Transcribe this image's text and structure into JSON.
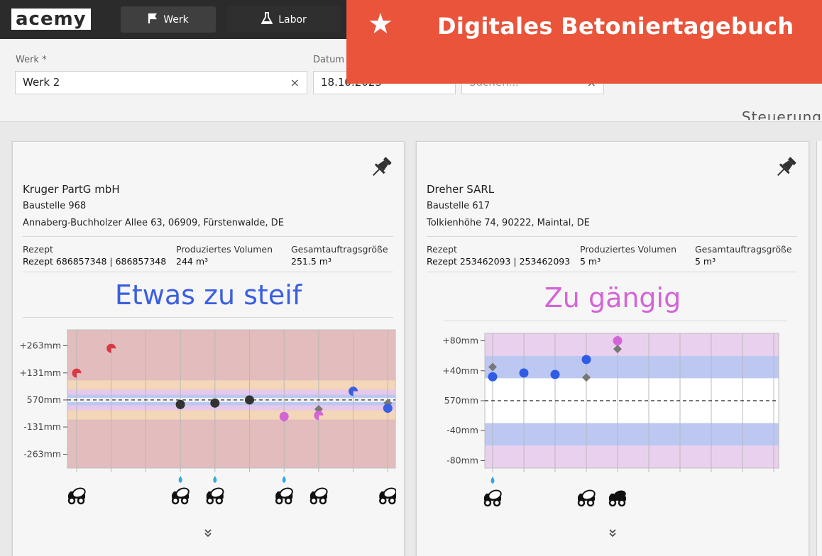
{
  "nav": {
    "logo": "acemy",
    "werk_label": "Werk",
    "labor_label": "Labor"
  },
  "banner": {
    "title": "Digitales Betoniertagebuch",
    "star_icon": "star-icon"
  },
  "filters": {
    "werk_label": "Werk *",
    "werk_value": "Werk 2",
    "datum_label": "Datum",
    "datum_value": "18.10.2023",
    "search_placeholder": "Suchen...",
    "clear_symbol": "×",
    "cut_text": "Steuerung"
  },
  "cards": [
    {
      "company": "Kruger PartG mbH",
      "site": "Baustelle 968",
      "address": "Annaberg-Buchholzer Allee 63, 06909, Fürstenwalde, DE",
      "recipe_header": "Rezept",
      "recipe_value": "Rezept 686857348 | 686857348",
      "volume_header": "Produziertes Volumen",
      "volume_value": "244 m³",
      "order_header": "Gesamtauftragsgröße",
      "order_value": "251.5 m³",
      "status": "Etwas zu steif",
      "status_color": "#3a5fe0",
      "expand_icon": "chevron-double-down-icon"
    },
    {
      "company": "Dreher SARL",
      "site": "Baustelle 617",
      "address": "Tolkienhöhe 74, 90222, Maintal, DE",
      "recipe_header": "Rezept",
      "recipe_value": "Rezept 253462093 | 253462093",
      "volume_header": "Produziertes Volumen",
      "volume_value": "5 m³",
      "order_header": "Gesamtauftragsgröße",
      "order_value": "5 m³",
      "status": "Zu gängig",
      "status_color": "#d465d6",
      "expand_icon": "chevron-double-down-icon"
    }
  ],
  "chart_data": [
    {
      "type": "scatter",
      "yticklabels": [
        "+263mm",
        "+131mm",
        "570mm",
        "-131mm",
        "-263mm"
      ],
      "yticks": [
        263,
        131,
        0,
        -131,
        -263
      ],
      "ylim": [
        -330,
        340
      ],
      "reference": 0,
      "slots": 10,
      "background": "#e3bcbd",
      "bands": [
        {
          "from": 50,
          "to": 95,
          "color": "#f4d6b8"
        },
        {
          "from": -95,
          "to": -50,
          "color": "#f4d6b8"
        },
        {
          "from": 25,
          "to": 50,
          "color": "#e6c8ea"
        },
        {
          "from": -50,
          "to": -25,
          "color": "#e6c8ea"
        },
        {
          "from": 10,
          "to": 25,
          "color": "#b9c9f2"
        },
        {
          "from": -25,
          "to": -10,
          "color": "#b9c9f2"
        },
        {
          "from": -10,
          "to": 10,
          "color": "#f3f3f3"
        }
      ],
      "markers": [
        {
          "slot": 0,
          "value": 130,
          "color": "#d63a44",
          "shape": "pie"
        },
        {
          "slot": 1,
          "value": 250,
          "color": "#d63a44",
          "shape": "pie"
        },
        {
          "slot": 3,
          "value": -22,
          "color": "#333333",
          "shape": "dot"
        },
        {
          "slot": 4,
          "value": -15,
          "color": "#333333",
          "shape": "dot"
        },
        {
          "slot": 5,
          "value": 0,
          "color": "#333333",
          "shape": "dot"
        },
        {
          "slot": 6,
          "value": -85,
          "color": "#666666",
          "shape": "diamond"
        },
        {
          "slot": 6,
          "value": -80,
          "color": "#d465d6",
          "shape": "dot"
        },
        {
          "slot": 7,
          "value": -45,
          "color": "#777777",
          "shape": "diamond"
        },
        {
          "slot": 7,
          "value": -75,
          "color": "#d465d6",
          "shape": "pie"
        },
        {
          "slot": 8,
          "value": 42,
          "color": "#3a5fe0",
          "shape": "pie"
        },
        {
          "slot": 9,
          "value": -15,
          "color": "#777777",
          "shape": "diamond"
        },
        {
          "slot": 9,
          "value": -40,
          "color": "#3a5fe0",
          "shape": "dot"
        }
      ],
      "drops": [
        3,
        4,
        6
      ],
      "trucks": [
        {
          "slot": 0,
          "style": "mixer"
        },
        {
          "slot": 3,
          "style": "mixer"
        },
        {
          "slot": 4,
          "style": "mixer"
        },
        {
          "slot": 6,
          "style": "mixer"
        },
        {
          "slot": 7,
          "style": "mixer"
        },
        {
          "slot": 9,
          "style": "mixer"
        }
      ]
    },
    {
      "type": "scatter",
      "yticklabels": [
        "+80mm",
        "+40mm",
        "570mm",
        "-40mm",
        "-80mm"
      ],
      "yticks": [
        80,
        40,
        0,
        -40,
        -80
      ],
      "ylim": [
        -90,
        90
      ],
      "reference": 0,
      "slots": 10,
      "background": "#ffffff",
      "bands": [
        {
          "from": 60,
          "to": 90,
          "color": "#ead0ef"
        },
        {
          "from": -90,
          "to": -60,
          "color": "#ead0ef"
        },
        {
          "from": 30,
          "to": 60,
          "color": "#bcc8f2"
        },
        {
          "from": -60,
          "to": -30,
          "color": "#bcc8f2"
        }
      ],
      "markers": [
        {
          "slot": 0,
          "value": 45,
          "color": "#777777",
          "shape": "diamond"
        },
        {
          "slot": 0,
          "value": 32,
          "color": "#2f5be6",
          "shape": "dot"
        },
        {
          "slot": 1,
          "value": 37,
          "color": "#2f5be6",
          "shape": "dot"
        },
        {
          "slot": 2,
          "value": 35,
          "color": "#2f5be6",
          "shape": "dot"
        },
        {
          "slot": 3,
          "value": 55,
          "color": "#2f5be6",
          "shape": "dot"
        },
        {
          "slot": 3,
          "value": 31,
          "color": "#777777",
          "shape": "diamond"
        },
        {
          "slot": 4,
          "value": 80,
          "color": "#d465d6",
          "shape": "dot"
        },
        {
          "slot": 4,
          "value": 69,
          "color": "#777777",
          "shape": "diamond"
        }
      ],
      "drops": [
        0
      ],
      "trucks": [
        {
          "slot": 0,
          "style": "mixer"
        },
        {
          "slot": 3,
          "style": "mixer"
        },
        {
          "slot": 4,
          "style": "mixer-dark"
        }
      ]
    }
  ]
}
